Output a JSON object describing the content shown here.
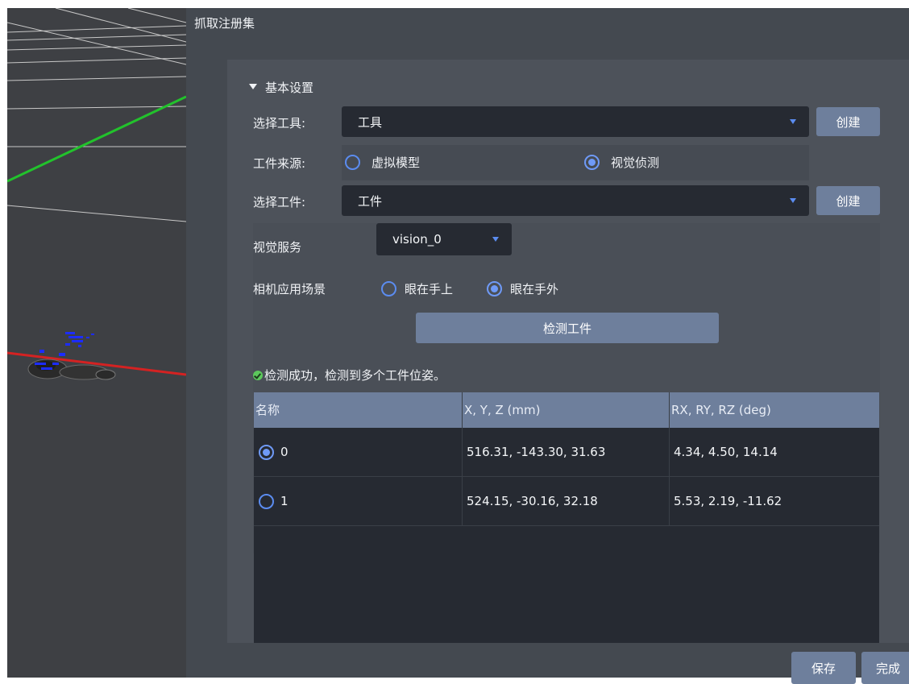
{
  "window": {
    "title": "抓取注册集"
  },
  "section": {
    "toggle_icon": "triangle-down-icon",
    "label": "基本设置"
  },
  "tool": {
    "label": "选择工具:",
    "value": "工具",
    "create_label": "创建"
  },
  "source": {
    "label": "工件来源:",
    "options": [
      "虚拟模型",
      "视觉侦测"
    ],
    "selected": "视觉侦测"
  },
  "workpiece": {
    "label": "选择工件:",
    "value": "工件",
    "create_label": "创建"
  },
  "vision": {
    "label": "视觉服务",
    "value": "vision_0"
  },
  "camera": {
    "label": "相机应用场景",
    "options": [
      "眼在手上",
      "眼在手外"
    ],
    "selected": "眼在手外"
  },
  "detect_button": {
    "label": "检测工件"
  },
  "status": {
    "icon": "check-circle-icon",
    "message": "检测成功，检测到多个工件位姿。"
  },
  "table": {
    "headers": [
      "名称",
      "X, Y, Z (mm)",
      "RX, RY, RZ (deg)"
    ],
    "rows": [
      {
        "name": "0",
        "xyz": "516.31, -143.30, 31.63",
        "rxyz": "4.34, 4.50, 14.14",
        "selected": true
      },
      {
        "name": "1",
        "xyz": "524.15, -30.16, 32.18",
        "rxyz": "5.53, 2.19, -11.62",
        "selected": false
      }
    ]
  },
  "footer": {
    "save_label": "保存",
    "done_label": "完成"
  },
  "colors": {
    "accent": "#5b8cf0",
    "button": "#6e7f9c",
    "panel": "#444950",
    "field": "#262a32",
    "success": "#5cc85c"
  }
}
